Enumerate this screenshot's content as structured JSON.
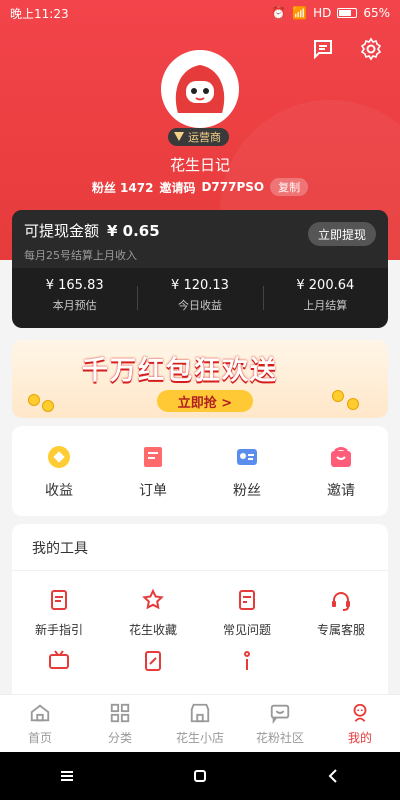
{
  "status_bar": {
    "time": "晚上11:23",
    "network": "HD",
    "battery": "65%"
  },
  "header": {
    "badge_role": "运营商",
    "nickname": "花生日记",
    "fans_label": "粉丝 1472",
    "invite_label": "邀请码",
    "invite_code": "D777PSO",
    "copy_label": "复制"
  },
  "earnings": {
    "title": "可提现金额",
    "amount": "¥ 0.65",
    "subtitle": "每月25号结算上月收入",
    "withdraw_label": "立即提现",
    "cells": [
      {
        "value": "¥ 165.83",
        "label": "本月预估"
      },
      {
        "value": "¥ 120.13",
        "label": "今日收益"
      },
      {
        "value": "¥ 200.64",
        "label": "上月结算"
      }
    ]
  },
  "banner": {
    "title": "千万红包狂欢送",
    "cta": "立即抢 >"
  },
  "quick": [
    {
      "label": "收益",
      "icon": "coin-icon",
      "color": "#ffcc33"
    },
    {
      "label": "订单",
      "icon": "order-icon",
      "color": "#ff6b6b"
    },
    {
      "label": "粉丝",
      "icon": "fans-icon",
      "color": "#5b8def"
    },
    {
      "label": "邀请",
      "icon": "invite-icon",
      "color": "#ff5c7a"
    }
  ],
  "tools": {
    "title": "我的工具",
    "items": [
      {
        "label": "新手指引",
        "icon": "guide-icon"
      },
      {
        "label": "花生收藏",
        "icon": "star-icon"
      },
      {
        "label": "常见问题",
        "icon": "faq-icon"
      },
      {
        "label": "专属客服",
        "icon": "headset-icon"
      },
      {
        "label": "",
        "icon": "tv-icon"
      },
      {
        "label": "",
        "icon": "doc-edit-icon"
      },
      {
        "label": "",
        "icon": "info-icon"
      },
      {
        "label": "",
        "icon": ""
      }
    ]
  },
  "bottom_nav": [
    {
      "label": "首页",
      "icon": "home-icon"
    },
    {
      "label": "分类",
      "icon": "category-icon"
    },
    {
      "label": "花生小店",
      "icon": "shop-icon"
    },
    {
      "label": "花粉社区",
      "icon": "community-icon"
    },
    {
      "label": "我的",
      "icon": "profile-icon",
      "active": true
    }
  ],
  "colors": {
    "brand_red": "#e63b3b",
    "card_dark": "#1e1e1e"
  }
}
